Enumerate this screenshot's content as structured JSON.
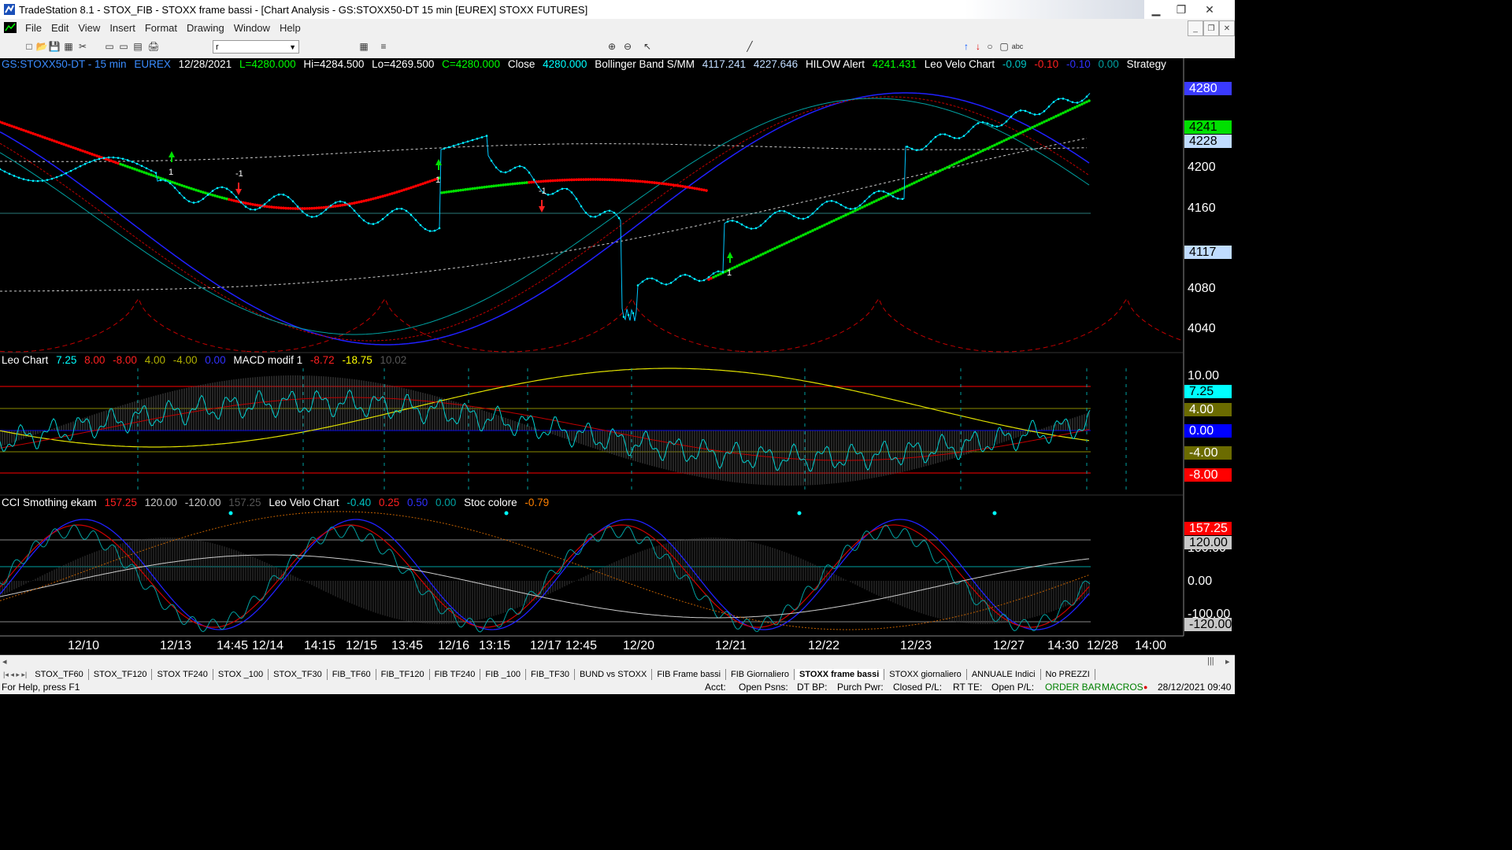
{
  "window": {
    "title": "TradeStation 8.1 - STOX_FIB - STOXX frame bassi - [Chart Analysis - GS:STOXX50-DT  15 min  [EUREX] STOXX FUTURES]",
    "minimize": "▁",
    "maximize": "❐",
    "close": "✕"
  },
  "menu": [
    "File",
    "Edit",
    "View",
    "Insert",
    "Format",
    "Drawing",
    "Window",
    "Help"
  ],
  "toolbar": {
    "combo_value": "r",
    "icons": [
      "new-icon",
      "open-icon",
      "save-icon",
      "print-icon",
      "chart-icon",
      "cut-icon",
      "copy-icon",
      "paste-icon",
      "find-icon",
      "grid-icon",
      "list-icon",
      "zoom-in-icon",
      "zoom-out-icon",
      "pointer-icon",
      "line-icon",
      "arrow-up-icon",
      "arrow-down-icon",
      "ellipse-icon",
      "rectangle-icon",
      "text-icon"
    ]
  },
  "price_header": {
    "symbol": "GS:STOXX50-DT - 15 min",
    "exchange": "EUREX",
    "date": "12/28/2021",
    "low_open": "L=4280.000",
    "high": "Hi=4284.500",
    "low": "Lo=4269.500",
    "close_val": "C=4280.000",
    "close_label": "Close",
    "close_num": "4280.000",
    "bb_label": "Bollinger Band S/MM",
    "bb_v1": "4117.241",
    "bb_v2": "4227.646",
    "hilow_label": "HILOW Alert",
    "hilow_val": "4241.431",
    "leo_label": "Leo Velo Chart",
    "leo_v1": "-0.09",
    "leo_v2": "-0.10",
    "leo_v3": "-0.10",
    "leo_v4": "0.00",
    "strategy": "Strategy"
  },
  "macd_header": {
    "label": "Leo Chart",
    "v1": "7.25",
    "v2": "8.00",
    "v3": "-8.00",
    "v4": "4.00",
    "v5": "-4.00",
    "v6": "0.00",
    "macd_label": "MACD modif 1",
    "m1": "-8.72",
    "m2": "-18.75",
    "m3": "10.02"
  },
  "cci_header": {
    "label": "CCI Smothing ekam",
    "v1": "157.25",
    "v2": "120.00",
    "v3": "-120.00",
    "v4": "157.25",
    "leo_label": "Leo Velo Chart",
    "l1": "-0.40",
    "l2": "0.25",
    "l3": "0.50",
    "l4": "0.00",
    "stoc_label": "Stoc colore",
    "stoc_val": "-0.79"
  },
  "price_axis": [
    "4200",
    "4160",
    "4080",
    "4040"
  ],
  "price_boxes": [
    {
      "text": "4280",
      "bg": "#3a3aff",
      "fg": "#ffffff"
    },
    {
      "text": "4241",
      "bg": "#00e000",
      "fg": "#000000"
    },
    {
      "text": "4228",
      "bg": "#c0dcff",
      "fg": "#000000"
    },
    {
      "text": "4117",
      "bg": "#c0dcff",
      "fg": "#000000"
    }
  ],
  "macd_axis": {
    "top": "10.00"
  },
  "macd_boxes": [
    {
      "text": "7.25",
      "bg": "#00ffff",
      "fg": "#000000"
    },
    {
      "text": "4.00",
      "bg": "#6b6b00",
      "fg": "#ffffff"
    },
    {
      "text": "0.00",
      "bg": "#0000ff",
      "fg": "#ffffff"
    },
    {
      "text": "-4.00",
      "bg": "#6b6b00",
      "fg": "#ffffff"
    },
    {
      "text": "-8.00",
      "bg": "#ff0000",
      "fg": "#ffffff"
    }
  ],
  "cci_axis": {
    "mid": "100.00",
    "zero": "0.00",
    "low": "-100.00"
  },
  "cci_boxes": [
    {
      "text": "157.25",
      "bg": "#ff0000",
      "fg": "#ffffff"
    },
    {
      "text": "120.00",
      "bg": "#c8c8c8",
      "fg": "#000000"
    },
    {
      "text": "-120.00",
      "bg": "#c8c8c8",
      "fg": "#000000"
    }
  ],
  "trade_labels": [
    "1",
    "-1",
    "1",
    "-1",
    "1"
  ],
  "dates": [
    "12/10",
    "12/13",
    "14:45",
    "12/14",
    "14:15",
    "12/15",
    "13:45",
    "12/16",
    "13:15",
    "12/17",
    "12:45",
    "12/20",
    "12/21",
    "12/22",
    "12/23",
    "12/27",
    "14:30",
    "12/28",
    "14:00"
  ],
  "tabs": [
    "STOX_TF60",
    "STOX_TF120",
    "STOX TF240",
    "STOX _100",
    "STOX_TF30",
    "FIB_TF60",
    "FIB_TF120",
    "FIB TF240",
    "FIB _100",
    "FIB_TF30",
    "BUND vs STOXX",
    "FIB Frame bassi",
    "FIB Giornaliero",
    "STOXX frame bassi",
    "STOXX giornaliero",
    "ANNUALE Indici",
    "No PREZZI"
  ],
  "active_tab": "STOXX frame bassi",
  "status": {
    "help": "For Help, press F1",
    "acct": "Acct:",
    "open_psns": "Open Psns:",
    "dt_bp": "DT BP:",
    "purch_pwr": "Purch Pwr:",
    "closed_pl": "Closed P/L:",
    "rt_te": "RT TE:",
    "open_pl": "Open P/L:",
    "order_bar": "ORDER BAR",
    "macros": "MACROS",
    "datetime": "28/12/2021 09:40"
  }
}
